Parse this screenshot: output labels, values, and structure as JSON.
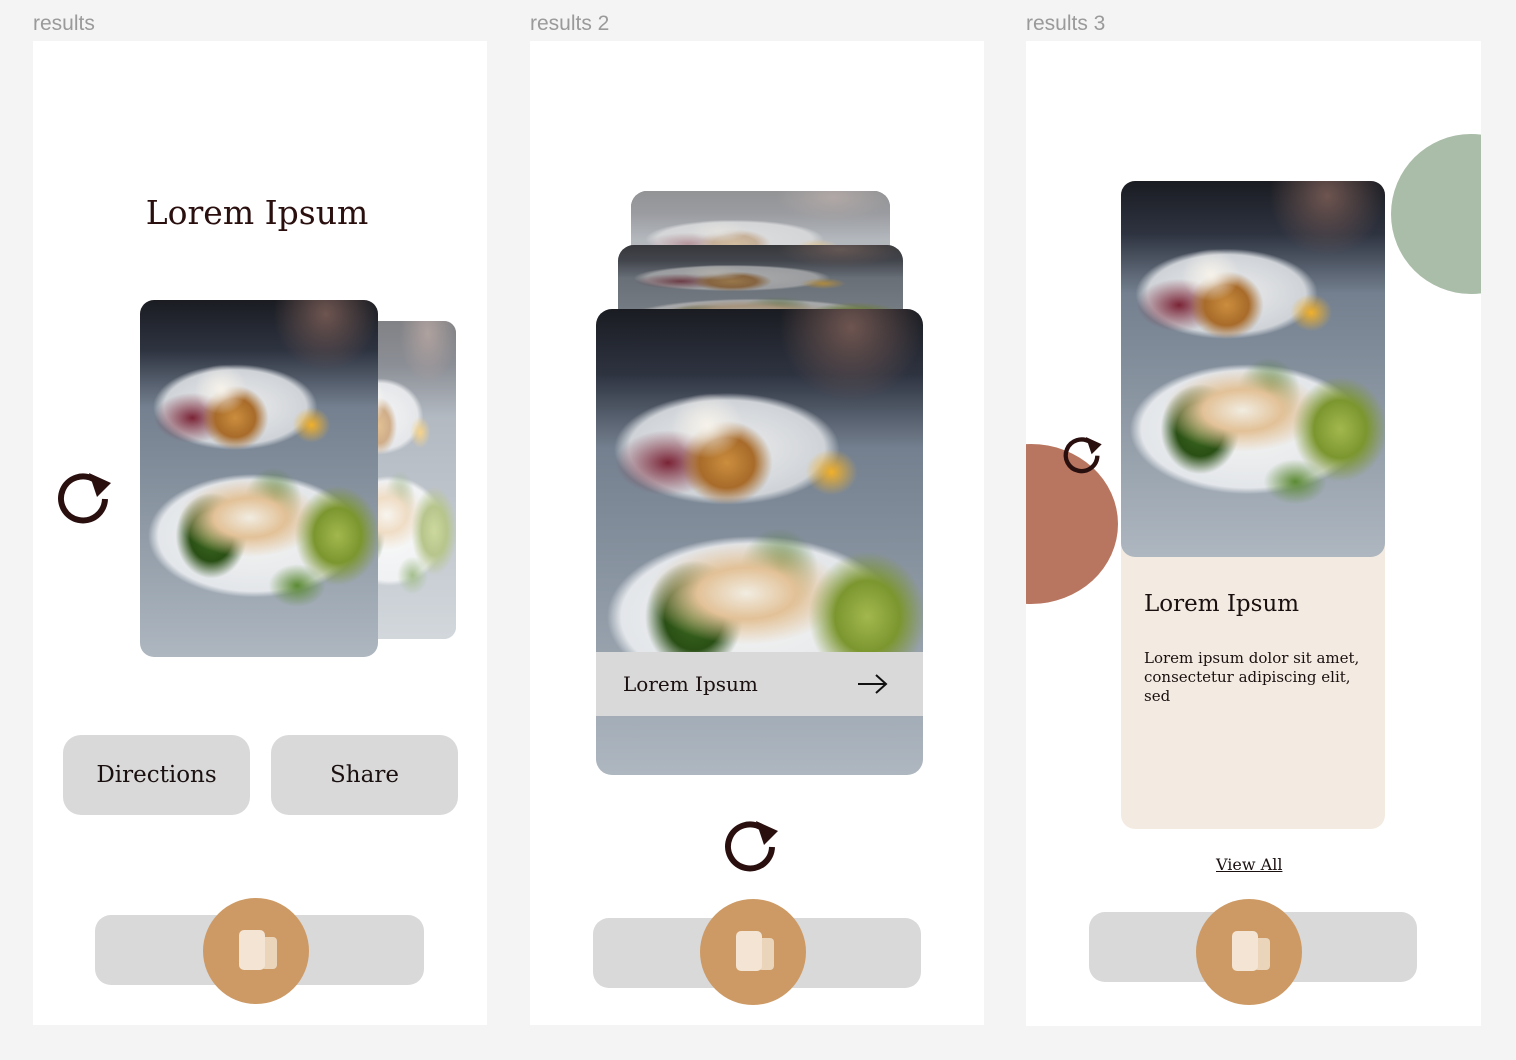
{
  "frames": [
    {
      "label": "results",
      "title": "Lorem Ipsum",
      "buttons": {
        "directions": "Directions",
        "share": "Share"
      },
      "icons": {
        "refresh": "refresh-icon",
        "fab": "cards-icon"
      }
    },
    {
      "label": "results 2",
      "card_title": "Lorem Ipsum",
      "icons": {
        "arrow": "arrow-right-icon",
        "refresh": "refresh-icon",
        "fab": "cards-icon"
      }
    },
    {
      "label": "results 3",
      "card_title": "Lorem Ipsum",
      "card_body": "Lorem ipsum dolor sit amet, consectetur adipiscing elit, sed",
      "view_all": "View All",
      "icons": {
        "refresh": "refresh-icon",
        "fab": "cards-icon"
      }
    }
  ],
  "colors": {
    "accent": "#cd9a65",
    "sage": "#a9bda8",
    "terracotta": "#b87660",
    "card_beige": "#f3ebe1",
    "button_gray": "#d9d9d9",
    "text_dark": "#2a0f0f"
  }
}
